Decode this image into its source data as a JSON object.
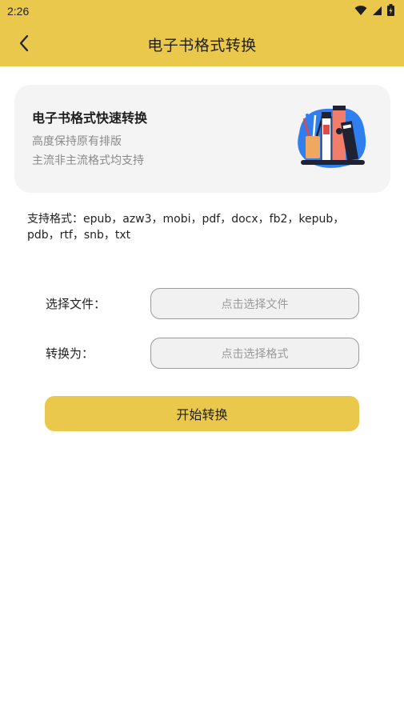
{
  "status_bar": {
    "time": "2:26"
  },
  "app_bar": {
    "title": "电子书格式转换"
  },
  "banner": {
    "heading": "电子书格式快速转换",
    "line1": "高度保持原有排版",
    "line2": "主流非主流格式均支持"
  },
  "supported_formats": "支持格式：epub，azw3，mobi，pdf，docx，fb2，kepub，pdb，rtf，snb，txt",
  "form": {
    "file_label": "选择文件：",
    "file_placeholder": "点击选择文件",
    "format_label": "转换为：",
    "format_placeholder": "点击选择格式"
  },
  "start_button": "开始转换",
  "colors": {
    "accent": "#E9C84B"
  }
}
